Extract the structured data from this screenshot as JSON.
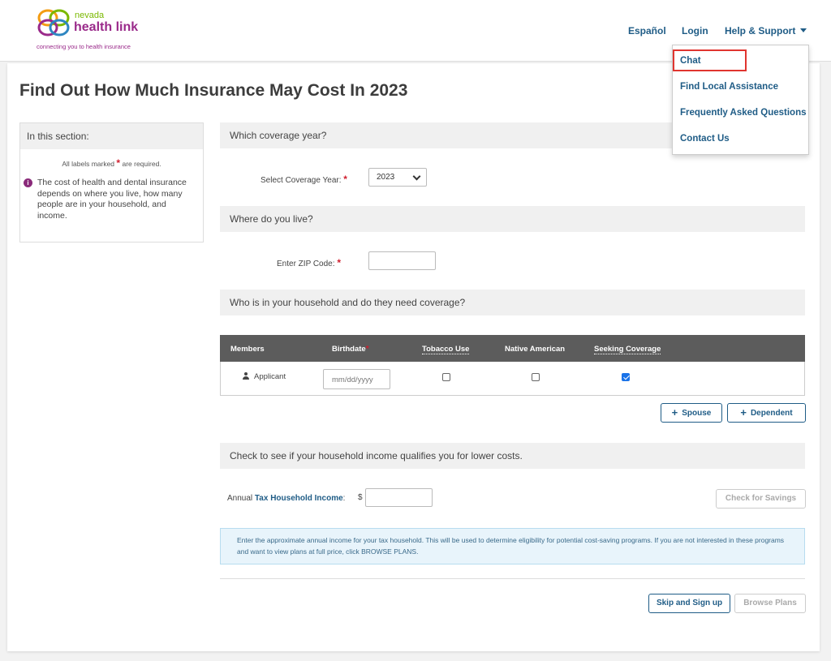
{
  "header": {
    "logo": {
      "nevada": "nevada",
      "health_link": "health link",
      "tagline": "connecting you to health insurance",
      "colors": [
        "#f39c12",
        "#7ab800",
        "#9a2a8a",
        "#2e86c1",
        "#e74c3c"
      ]
    },
    "nav": {
      "espanol": "Español",
      "login": "Login",
      "help_support": "Help & Support"
    }
  },
  "dropdown": {
    "items": [
      "Chat",
      "Find Local Assistance",
      "Frequently Asked Questions",
      "Contact Us"
    ],
    "highlight_color": "#e0352f"
  },
  "page": {
    "title": "Find Out How Much Insurance May Cost In 2023"
  },
  "sidebar": {
    "heading": "In this section:",
    "required_prefix": "All labels marked",
    "required_suffix": "are required.",
    "info_icon": "info-icon",
    "info_text": "The cost of health and dental insurance depends on where you live, how many people are in your household, and income."
  },
  "sections": {
    "coverage_year": "Which coverage year?",
    "where_live": "Where do you live?",
    "household": "Who is in your household and do they need coverage?",
    "income": "Check to see if your household income qualifies you for lower costs."
  },
  "form": {
    "required_mark": "*",
    "coverage_year_label": "Select Coverage Year:",
    "coverage_year_value": "2023",
    "zip_label": "Enter ZIP Code:",
    "zip_value": "",
    "income_label_prefix": "Annual ",
    "income_label_bold": "Tax Household Income",
    "income_label_suffix": ":",
    "income_currency": "$",
    "income_value": ""
  },
  "table": {
    "headers": {
      "members": "Members",
      "birthdate": "Birthdate",
      "tobacco": "Tobacco Use",
      "native": "Native American",
      "seeking": "Seeking Coverage"
    },
    "rows": [
      {
        "member": "Applicant",
        "birthdate_placeholder": "mm/dd/yyyy",
        "tobacco_use": false,
        "native_american": false,
        "seeking_coverage": true
      }
    ]
  },
  "buttons": {
    "spouse": "Spouse",
    "dependent": "Dependent",
    "check_savings": "Check for Savings",
    "skip_signup": "Skip and Sign up",
    "browse_plans": "Browse Plans"
  },
  "note": {
    "text": "Enter the approximate annual income for your tax household. This will be used to determine eligibility for potential cost-saving programs. If you are not interested in these programs and want to view plans at full price, click BROWSE PLANS."
  },
  "colors": {
    "link": "#1f5c86",
    "required": "#d01f2f",
    "table_header": "#5c5c5c",
    "note_bg": "#e8f4fb"
  }
}
